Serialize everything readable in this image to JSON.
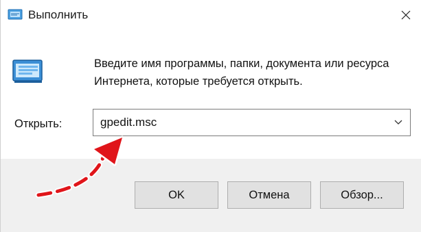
{
  "window": {
    "title": "Выполнить"
  },
  "prompt": {
    "description": "Введите имя программы, папки, документа или ресурса Интернета, которые требуется открыть."
  },
  "open_field": {
    "label": "Открыть:",
    "value": "gpedit.msc"
  },
  "buttons": {
    "ok": "OK",
    "cancel": "Отмена",
    "browse": "Обзор..."
  },
  "icons": {
    "title": "run-dialog-icon",
    "main": "run-dialog-icon",
    "close": "close-icon",
    "dropdown": "chevron-down-icon",
    "annotation": "red-curved-arrow-icon"
  },
  "colors": {
    "accent_arrow": "#e0151a",
    "footer_bg": "#f0f0f0",
    "button_bg": "#e1e1e1"
  }
}
